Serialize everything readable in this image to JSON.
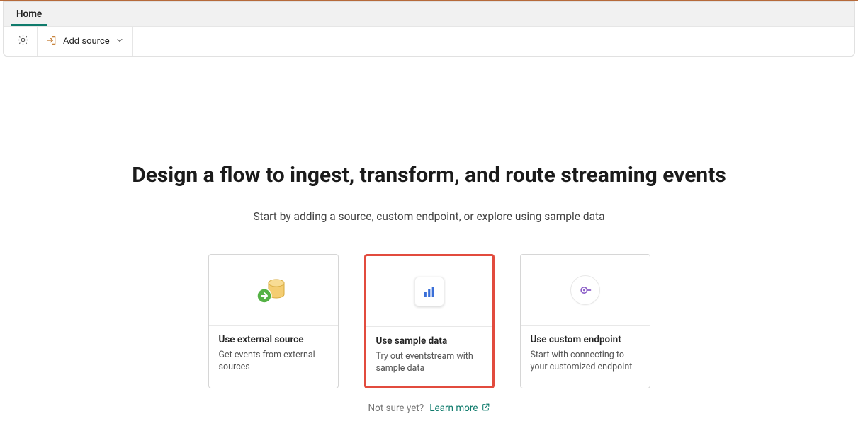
{
  "ribbon": {
    "tabs": [
      {
        "label": "Home"
      }
    ],
    "add_source_label": "Add source"
  },
  "content": {
    "headline": "Design a flow to ingest, transform, and route streaming events",
    "subhead": "Start by adding a source, custom endpoint, or explore using sample data"
  },
  "cards": [
    {
      "title": "Use external source",
      "desc": "Get events from external sources"
    },
    {
      "title": "Use sample data",
      "desc": "Try out eventstream with sample data"
    },
    {
      "title": "Use custom endpoint",
      "desc": "Start with connecting to your customized endpoint"
    }
  ],
  "footer": {
    "not_sure": "Not sure yet?",
    "learn_more": "Learn more"
  }
}
